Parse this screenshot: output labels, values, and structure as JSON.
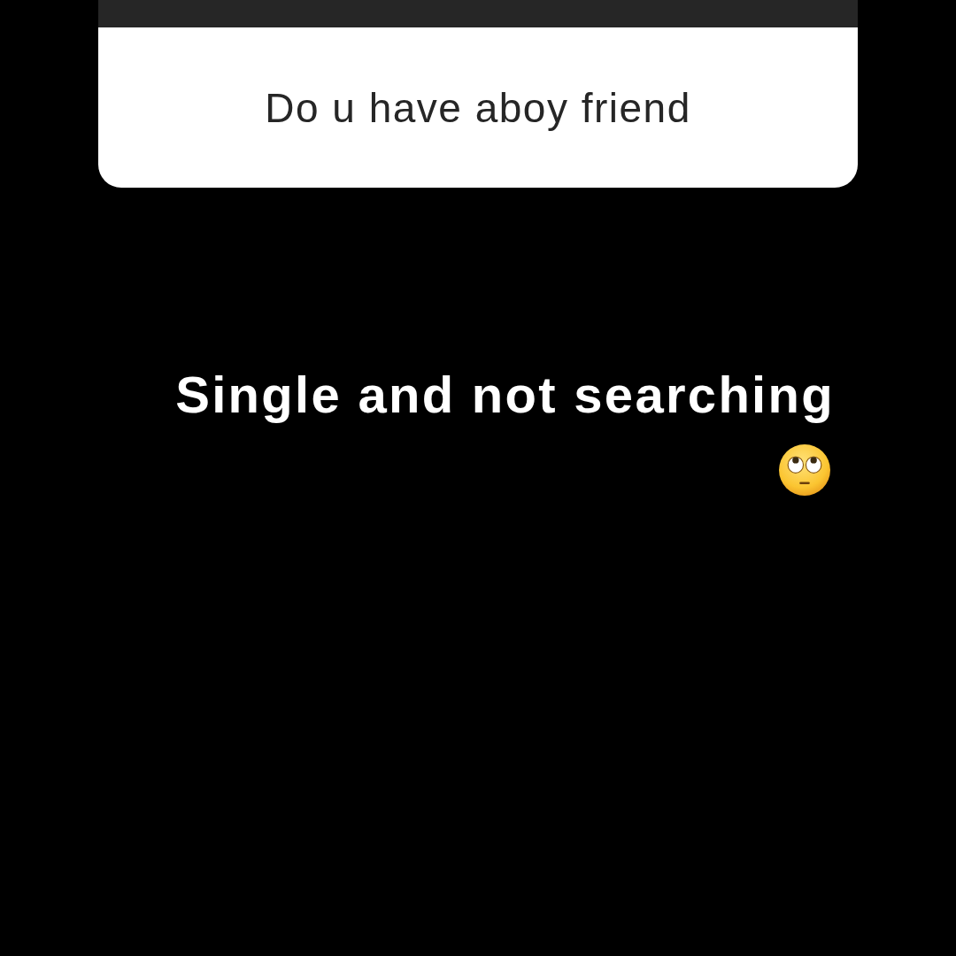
{
  "question_card": {
    "question": "Do u have aboy friend"
  },
  "answer": {
    "text": "Single and not searching"
  }
}
